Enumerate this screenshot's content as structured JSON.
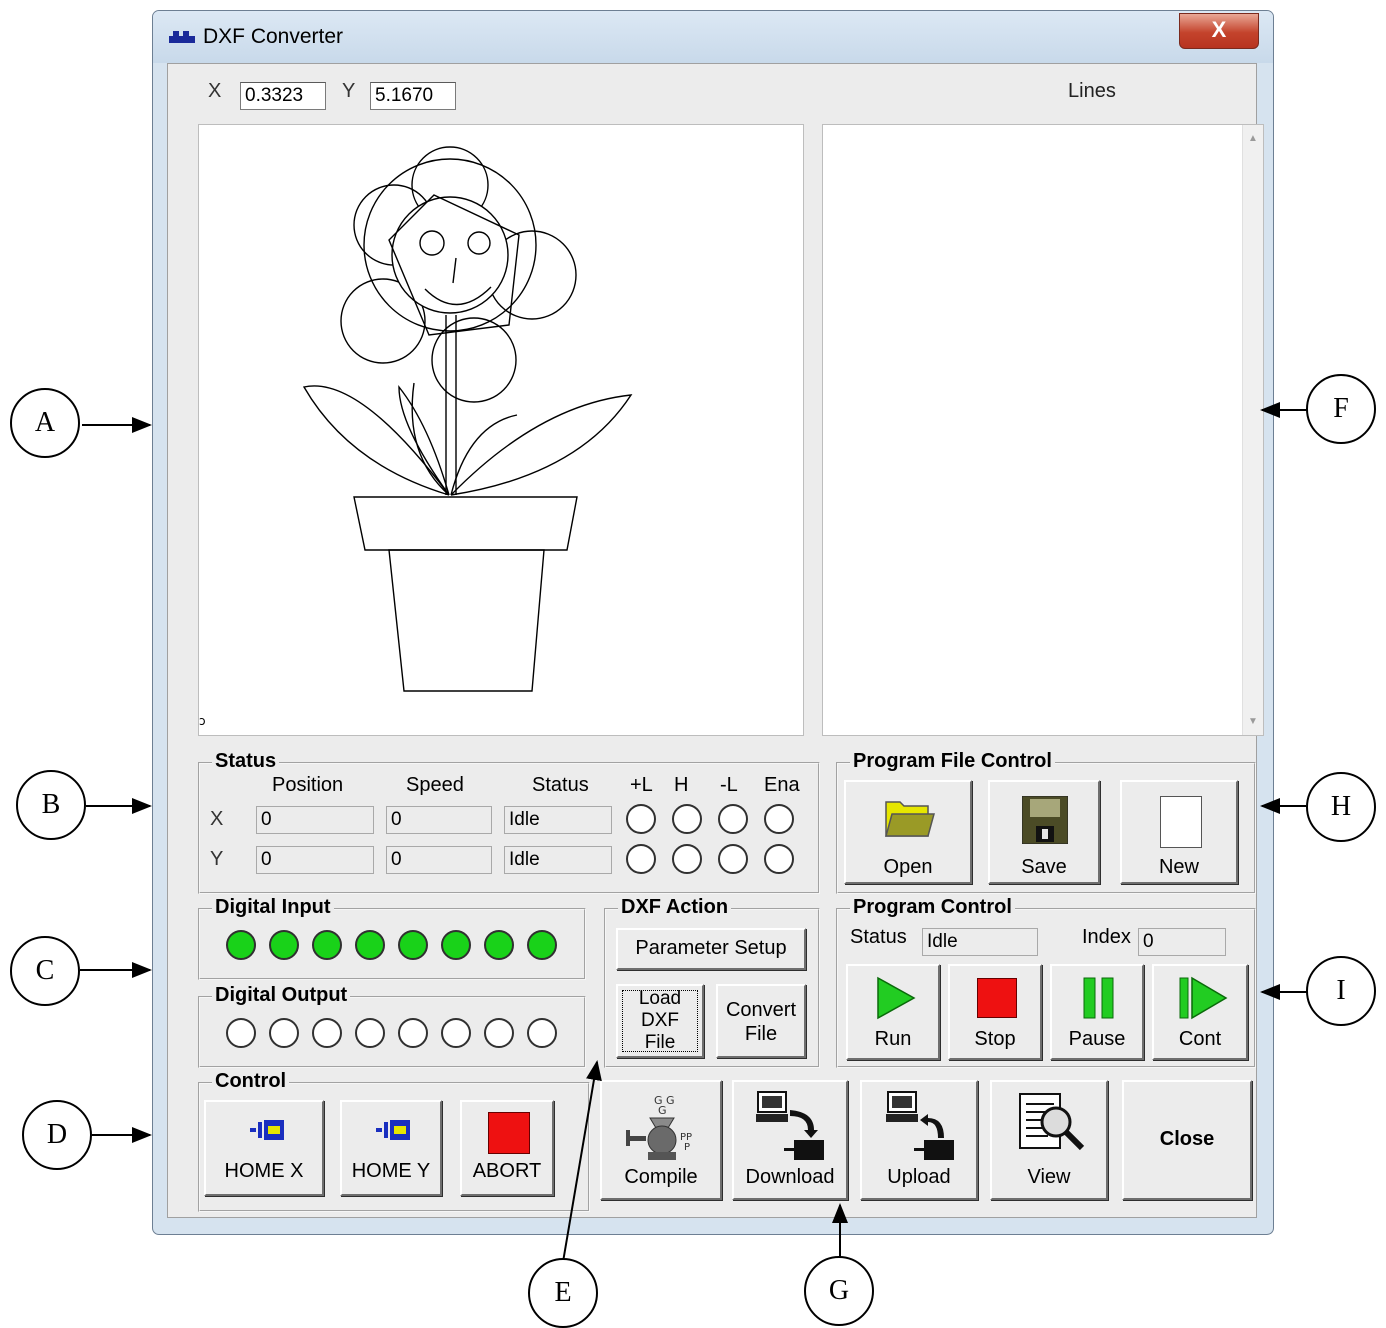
{
  "window": {
    "title": "DXF Converter",
    "close_glyph": "X"
  },
  "coords": {
    "x_label": "X",
    "x_value": "0.3323",
    "y_label": "Y",
    "y_value": "5.1670"
  },
  "lines_label": "Lines",
  "status": {
    "title": "Status",
    "headers": [
      "Position",
      "Speed",
      "Status",
      "+L",
      "H",
      "-L",
      "Ena"
    ],
    "rows": [
      {
        "axis": "X",
        "position": "0",
        "speed": "0",
        "status": "Idle",
        "limits": [
          false,
          false,
          false,
          false
        ]
      },
      {
        "axis": "Y",
        "position": "0",
        "speed": "0",
        "status": "Idle",
        "limits": [
          false,
          false,
          false,
          false
        ]
      }
    ]
  },
  "digital_input": {
    "title": "Digital Input",
    "states": [
      true,
      true,
      true,
      true,
      true,
      true,
      true,
      true
    ]
  },
  "digital_output": {
    "title": "Digital Output",
    "states": [
      false,
      false,
      false,
      false,
      false,
      false,
      false,
      false
    ]
  },
  "control": {
    "title": "Control",
    "home_x": "HOME X",
    "home_y": "HOME Y",
    "abort": "ABORT"
  },
  "dxf_action": {
    "title": "DXF Action",
    "parameter_setup": "Parameter Setup",
    "load_l1": "Load",
    "load_l2": "DXF",
    "load_l3": "File",
    "convert_l1": "Convert",
    "convert_l2": "File"
  },
  "program_file_control": {
    "title": "Program File Control",
    "open": "Open",
    "save": "Save",
    "new": "New"
  },
  "program_control": {
    "title": "Program Control",
    "status_label": "Status",
    "status_value": "Idle",
    "index_label": "Index",
    "index_value": "0",
    "run": "Run",
    "stop": "Stop",
    "pause": "Pause",
    "cont": "Cont"
  },
  "bottom": {
    "compile": "Compile",
    "download": "Download",
    "upload": "Upload",
    "view": "View",
    "close": "Close"
  },
  "callouts": [
    "A",
    "B",
    "C",
    "D",
    "E",
    "F",
    "G",
    "H",
    "I"
  ],
  "colors": {
    "led_on": "#19d219",
    "play_green": "#22cc22",
    "stop_red": "#ee1111",
    "home_blue": "#1a2fbf",
    "folder_yellow": "#e6e600"
  }
}
